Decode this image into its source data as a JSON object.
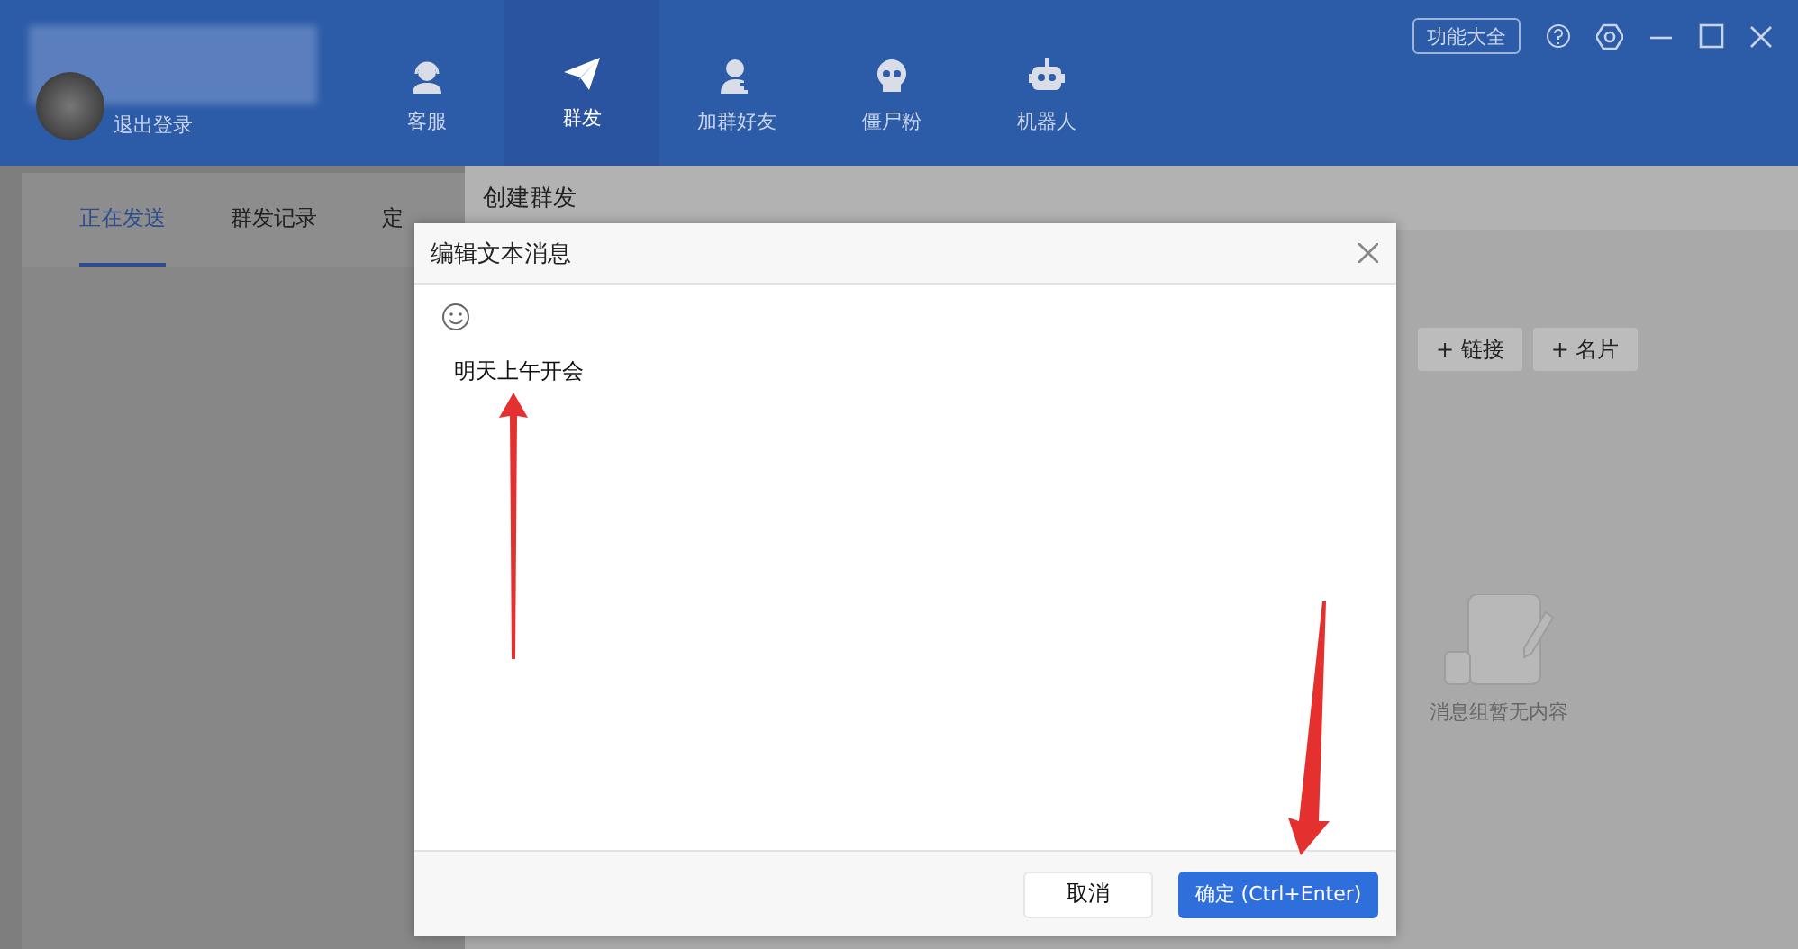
{
  "header": {
    "user": {
      "logout": "退出登录"
    },
    "nav": [
      {
        "label": "客服",
        "kind": "headset",
        "selected": false
      },
      {
        "label": "群发",
        "kind": "plane",
        "selected": true
      },
      {
        "label": "加群好友",
        "kind": "person",
        "selected": false
      },
      {
        "label": "僵尸粉",
        "kind": "skull",
        "selected": false
      },
      {
        "label": "机器人",
        "kind": "robot",
        "selected": false
      }
    ],
    "features_button": "功能大全"
  },
  "left_panel": {
    "tabs": [
      {
        "label": "正在发送",
        "selected": true
      },
      {
        "label": "群发记录",
        "selected": false
      },
      {
        "label": "定",
        "selected": false
      }
    ]
  },
  "main": {
    "title": "创建群发",
    "add_buttons": [
      "+ 链接",
      "+ 名片"
    ],
    "empty_text": "消息组暂无内容"
  },
  "dialog": {
    "title": "编辑文本消息",
    "value": "明天上午开会",
    "buttons": [
      {
        "label": "取消",
        "kind": "secondary"
      },
      {
        "label": "确定 (Ctrl+Enter)",
        "kind": "primary"
      }
    ]
  }
}
